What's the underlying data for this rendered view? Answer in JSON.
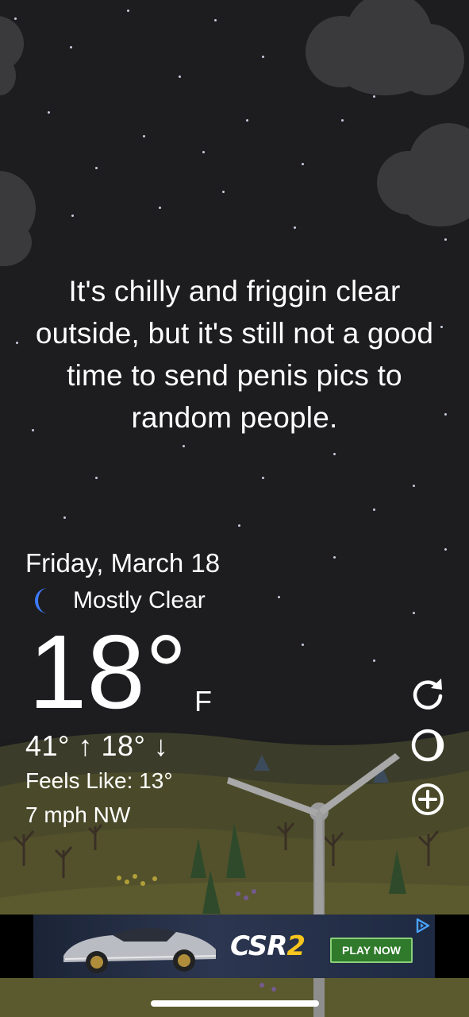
{
  "message": "It's chilly and friggin clear outside, but it's still not a good time to send penis pics to random people.",
  "date": "Friday, March 18",
  "condition": {
    "icon": "moon-icon",
    "text": "Mostly Clear"
  },
  "temperature": {
    "value": "18°",
    "unit": "F"
  },
  "high_low": "41° ↑  18° ↓",
  "feels_like": "Feels Like: 13°",
  "wind": "7 mph NW",
  "side_buttons": [
    {
      "icon": "refresh-icon"
    },
    {
      "icon": "moon-phase-icon"
    },
    {
      "icon": "add-location-icon"
    }
  ],
  "ad": {
    "brand_main": "CSR",
    "brand_accent": "2",
    "cta": "PLAY NOW",
    "choices_icon": "adchoices-icon"
  },
  "colors": {
    "moon": "#3d7bff",
    "cta_green": "#2f7a2b",
    "accent_yellow": "#f7c51e"
  }
}
